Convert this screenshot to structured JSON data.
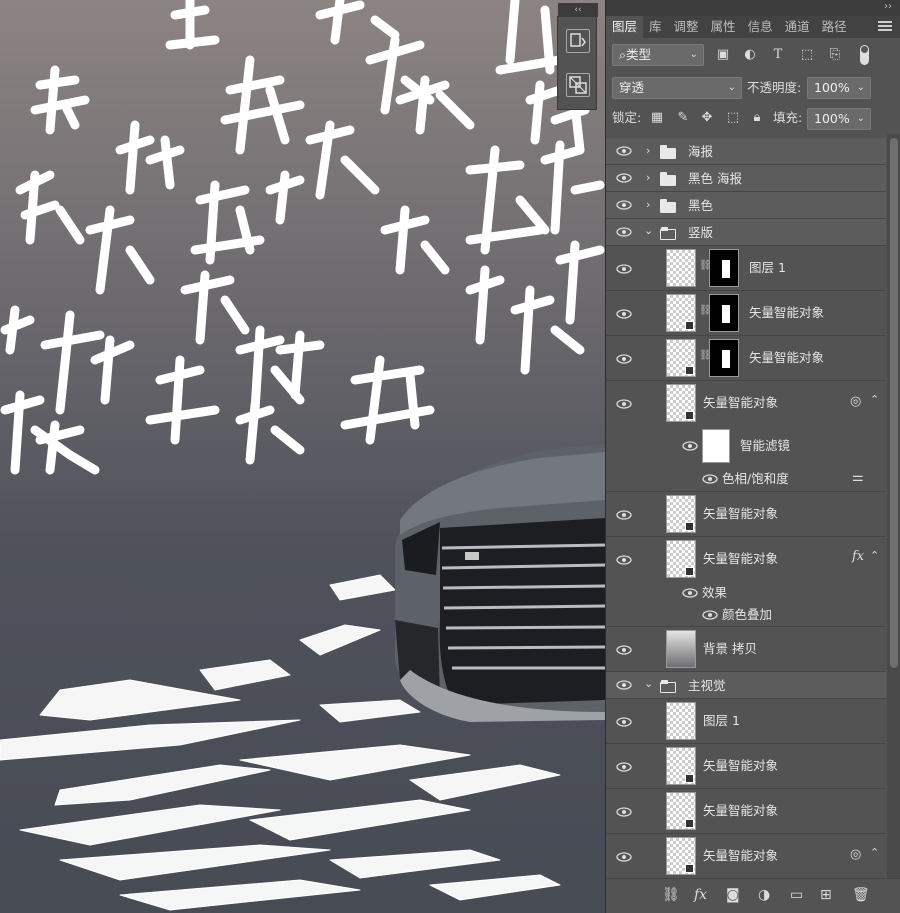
{
  "panel": {
    "tabs": [
      "图层",
      "库",
      "调整",
      "属性",
      "信息",
      "通道",
      "路径"
    ],
    "filter_kind": "类型",
    "blend_mode": "穿透",
    "opacity_label": "不透明度:",
    "opacity_value": "100%",
    "lock_label": "锁定:",
    "fill_label": "填充:",
    "fill_value": "100%",
    "collapse_glyph": "‹‹",
    "expand_glyph": "››"
  },
  "layers": [
    {
      "name": "海报",
      "kind": "group",
      "open": false
    },
    {
      "name": "黑色 海报",
      "kind": "group",
      "open": false
    },
    {
      "name": "黑色",
      "kind": "group",
      "open": false
    },
    {
      "name": "竖版",
      "kind": "group",
      "open": true
    },
    {
      "name": "图层 1",
      "kind": "layer-mask"
    },
    {
      "name": "矢量智能对象",
      "kind": "smart-mask"
    },
    {
      "name": "矢量智能对象",
      "kind": "smart-mask"
    },
    {
      "name": "矢量智能对象",
      "kind": "smart-filter"
    },
    {
      "name": "智能滤镜",
      "kind": "filter-mask"
    },
    {
      "name": "色相/饱和度",
      "kind": "filter-item"
    },
    {
      "name": "矢量智能对象",
      "kind": "smart"
    },
    {
      "name": "矢量智能对象",
      "kind": "smart-fx",
      "fx": "fx"
    },
    {
      "name": "效果",
      "kind": "effects"
    },
    {
      "name": "颜色叠加",
      "kind": "effect-item"
    },
    {
      "name": "背景 拷贝",
      "kind": "plain"
    },
    {
      "name": "主视觉",
      "kind": "group",
      "open": true
    },
    {
      "name": "图层 1",
      "kind": "plain2"
    },
    {
      "name": "矢量智能对象",
      "kind": "smart"
    },
    {
      "name": "矢量智能对象",
      "kind": "smart"
    },
    {
      "name": "矢量智能对象",
      "kind": "smart-filter2"
    }
  ],
  "colors": {
    "panel_bg": "#535353",
    "tab_bg": "#424242",
    "canvas_top": "#8c8482",
    "canvas_bottom": "#474b54"
  },
  "icons": {
    "bottom": [
      "link-icon",
      "fx-icon",
      "mask-icon",
      "adjustment-icon",
      "new-group-icon",
      "new-layer-icon",
      "delete-icon"
    ]
  }
}
